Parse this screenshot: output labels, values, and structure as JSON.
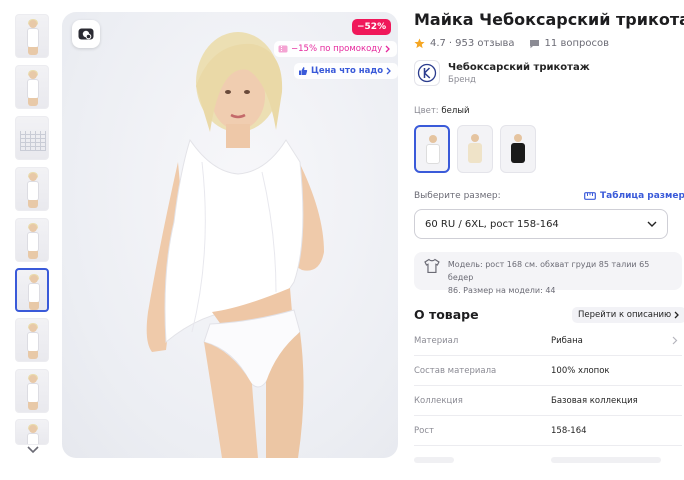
{
  "product": {
    "title": "Майка Чебоксарский трикотаж",
    "rating": "4.7",
    "reviews": "953 отзыва",
    "questions": "11 вопросов",
    "brand_name": "Чебоксарский трикотаж",
    "brand_role": "Бренд"
  },
  "photo": {
    "discount": "−52%",
    "promo": "−15% по промокоду",
    "price_tag": "Цена что надо"
  },
  "color": {
    "label": "Цвет:",
    "value": "белый",
    "options": [
      "белый",
      "бежевый",
      "черный"
    ],
    "swatch_colors": [
      "#ffffff",
      "#efe3c8",
      "#1a1a1a"
    ]
  },
  "size": {
    "label": "Выберите размер:",
    "table_link": "Таблица размеров",
    "selected": "60 RU / 6XL, рост 158-164"
  },
  "model_info": {
    "line1": "Модель: рост 168 см. обхват груди 85 талии 65 бедер",
    "line2": "86. Размер на модели: 44"
  },
  "about": {
    "title": "О товаре",
    "to_description": "Перейти к описанию",
    "specs": [
      {
        "key": "Материал",
        "value": "Рибана"
      },
      {
        "key": "Состав материала",
        "value": "100% хлопок"
      },
      {
        "key": "Коллекция",
        "value": "Базовая коллекция"
      },
      {
        "key": "Рост",
        "value": "158-164"
      }
    ]
  },
  "colors": {
    "accent": "#3a5ad9",
    "discount": "#f0185a",
    "promo": "#e6289d",
    "star": "#f5a623"
  }
}
